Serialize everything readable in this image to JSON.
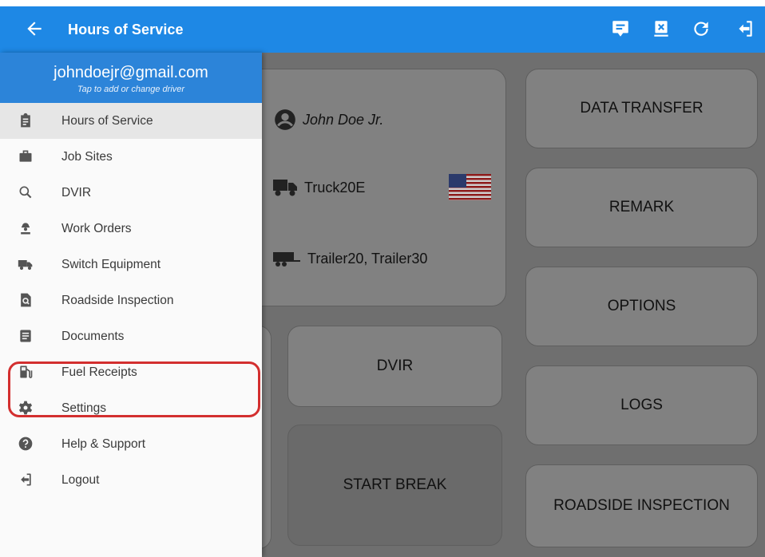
{
  "appbar": {
    "title": "Hours of Service",
    "actions": [
      "message-icon",
      "transfer-icon",
      "refresh-icon",
      "logout-icon"
    ],
    "color": "#1e88e5"
  },
  "drawer": {
    "email": "johndoejr@gmail.com",
    "subtitle": "Tap to add or change driver",
    "items": [
      {
        "label": "Hours of Service",
        "icon": "clipboard-icon",
        "active": true
      },
      {
        "label": "Job Sites",
        "icon": "briefcase-icon"
      },
      {
        "label": "DVIR",
        "icon": "search-icon"
      },
      {
        "label": "Work Orders",
        "icon": "worker-icon"
      },
      {
        "label": "Switch Equipment",
        "icon": "truck-icon"
      },
      {
        "label": "Roadside Inspection",
        "icon": "inspection-icon"
      },
      {
        "label": "Documents",
        "icon": "document-icon",
        "highlighted": true
      },
      {
        "label": "Fuel Receipts",
        "icon": "fuel-icon"
      },
      {
        "label": "Settings",
        "icon": "gear-icon"
      },
      {
        "label": "Help & Support",
        "icon": "help-icon"
      },
      {
        "label": "Logout",
        "icon": "logout-icon"
      }
    ]
  },
  "main": {
    "driver": "John Doe Jr.",
    "vehicle": "Truck20E",
    "trailers": "Trailer20, Trailer30",
    "buttons": {
      "data_transfer": "DATA TRANSFER",
      "remark": "REMARK",
      "options": "OPTIONS",
      "logs": "LOGS",
      "roadside": "ROADSIDE INSPECTION",
      "dvir": "DVIR",
      "start_break": "START BREAK"
    }
  }
}
